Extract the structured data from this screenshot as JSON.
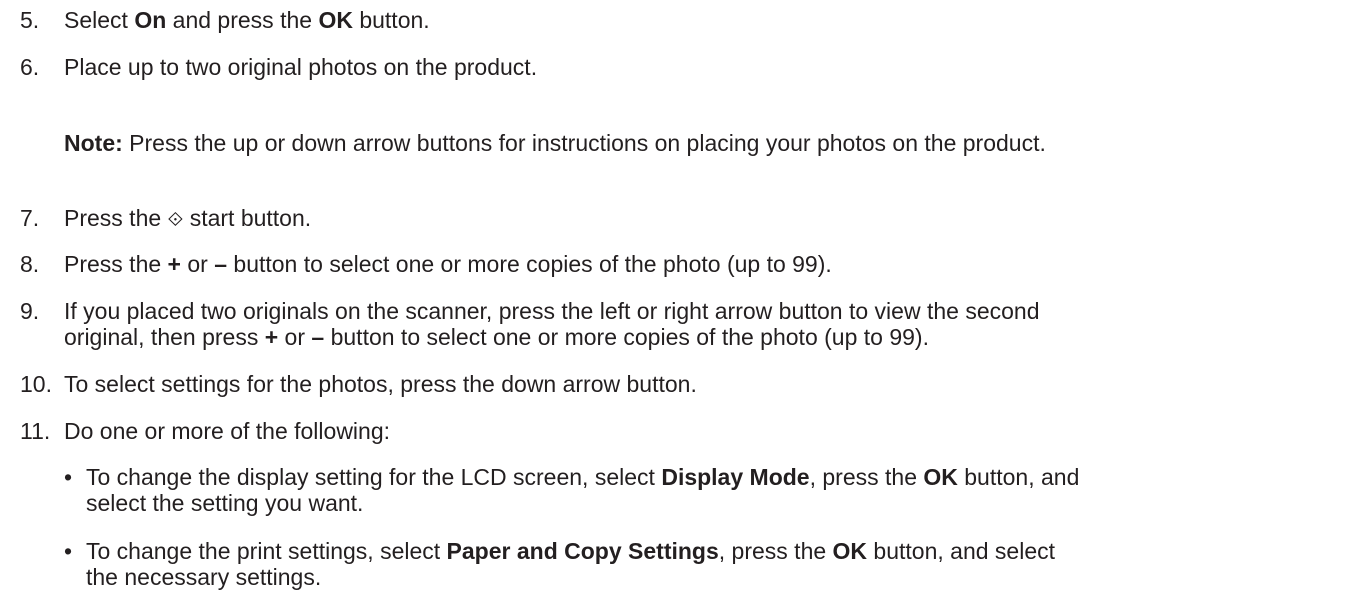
{
  "steps": [
    {
      "num": "5.",
      "parts": [
        "Select ",
        "On",
        " and press the ",
        "OK",
        " button."
      ]
    },
    {
      "num": "6.",
      "text": "Place up to two original photos on the product."
    },
    {
      "num": "7.",
      "before": "Press the ",
      "icon": "start-icon",
      "icon_glyph": "⟐",
      "after": " start button."
    },
    {
      "num": "8.",
      "parts": [
        "Press the ",
        "+",
        " or ",
        "–",
        " button to select one or more copies of the photo (up to 99)."
      ]
    },
    {
      "num": "9.",
      "line1": "If you placed two originals on the scanner, press the left or right arrow button to view the second",
      "line2_parts": [
        "original, then press ",
        "+",
        " or ",
        "–",
        " button to select one or more copies of the photo (up to 99)."
      ]
    },
    {
      "num": "10.",
      "text": "To select settings for the photos, press the down arrow button."
    },
    {
      "num": "11.",
      "text": "Do one or more of the following:"
    }
  ],
  "note": {
    "label": "Note:",
    "text": " Press the up or down arrow buttons for instructions on placing your photos on the product."
  },
  "bullets": [
    {
      "line1_parts": [
        "To change the display setting for the LCD screen, select ",
        "Display Mode",
        ", press the ",
        "OK",
        " button, and"
      ],
      "line2": "select the setting you want."
    },
    {
      "line1_parts": [
        "To change the print settings, select ",
        "Paper and Copy Settings",
        ", press the ",
        "OK",
        " button, and select"
      ],
      "line2": "the necessary settings."
    }
  ],
  "bullet_glyph": "•"
}
